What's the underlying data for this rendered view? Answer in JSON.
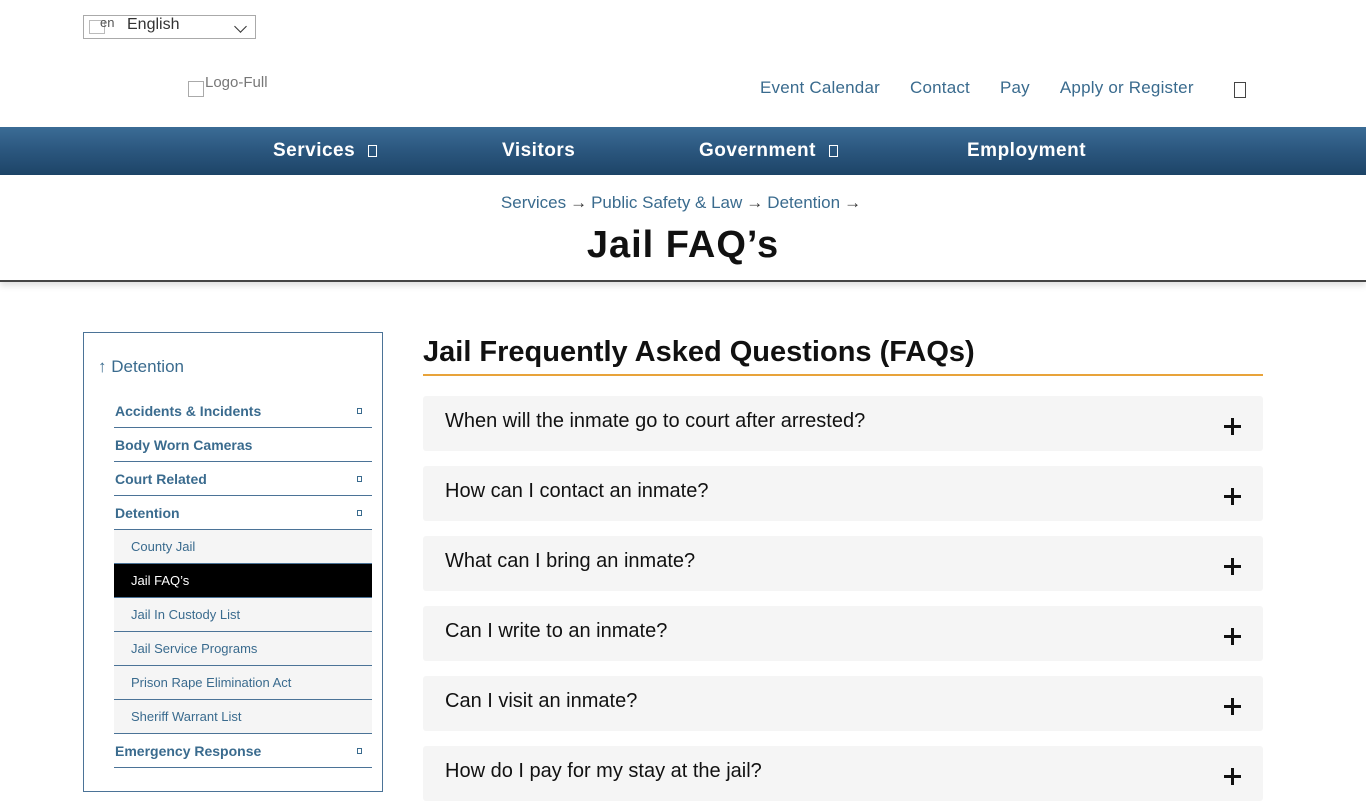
{
  "language": {
    "flag_alt": "en",
    "selected": "English"
  },
  "logo": {
    "alt": "Logo-Full"
  },
  "utility_nav": [
    "Event Calendar",
    "Contact",
    "Pay",
    "Apply or Register"
  ],
  "main_nav": [
    {
      "label": "Services",
      "has_dropdown": true
    },
    {
      "label": "Visitors",
      "has_dropdown": false
    },
    {
      "label": "Government",
      "has_dropdown": true
    },
    {
      "label": "Employment",
      "has_dropdown": false
    }
  ],
  "breadcrumb": [
    "Services",
    "Public Safety & Law",
    "Detention"
  ],
  "breadcrumb_separator": "→",
  "page_title": "Jail FAQ’s",
  "sidebar": {
    "back_label": "↑ Detention",
    "items": [
      {
        "label": "Accidents & Incidents",
        "expandable": true
      },
      {
        "label": "Body Worn Cameras",
        "expandable": false
      },
      {
        "label": "Court Related",
        "expandable": true
      },
      {
        "label": "Detention",
        "expandable": true
      }
    ],
    "sub_items": [
      {
        "label": "County Jail",
        "active": false
      },
      {
        "label": "Jail FAQ’s",
        "active": true
      },
      {
        "label": "Jail In Custody List",
        "active": false
      },
      {
        "label": "Jail Service Programs",
        "active": false
      },
      {
        "label": "Prison Rape Elimination Act",
        "active": false
      },
      {
        "label": "Sheriff Warrant List",
        "active": false
      }
    ],
    "after_items": [
      {
        "label": "Emergency Response",
        "expandable": true
      }
    ]
  },
  "content": {
    "heading": "Jail Frequently Asked Questions (FAQs)",
    "faqs": [
      "When will the inmate go to court after arrested?",
      "How can I contact an inmate?",
      "What can I bring an inmate?",
      "Can I write to an inmate?",
      "Can I visit an inmate?",
      "How do I pay for my stay at the jail?"
    ]
  },
  "colors": {
    "link": "#3a6b8e",
    "nav_bg": "#2c5880",
    "accent_rule": "#e8a33a",
    "active_bg": "#000000",
    "faq_bg": "#f5f5f5"
  }
}
